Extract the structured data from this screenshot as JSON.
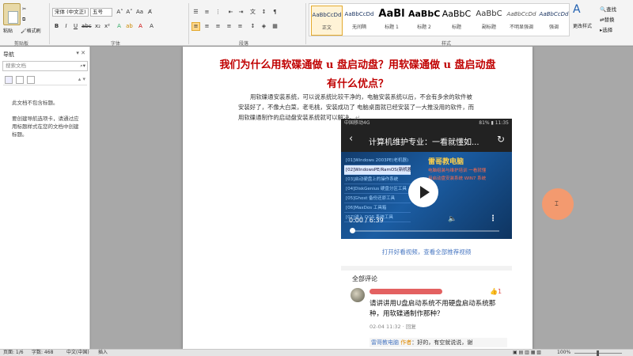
{
  "ribbon": {
    "clipboard": {
      "paste": "粘贴",
      "format_painter": "格式刷",
      "group": "剪贴板"
    },
    "font": {
      "font_name": "宋体 (中文正)",
      "font_size": "五号",
      "group": "字体"
    },
    "paragraph": {
      "group": "段落"
    },
    "styles": {
      "group": "样式",
      "items": [
        {
          "sample": "AaBbCcDd",
          "name": "正文"
        },
        {
          "sample": "AaBbCcDd",
          "name": "无间隔"
        },
        {
          "sample": "AaBl",
          "name": "标题 1"
        },
        {
          "sample": "AaBbC",
          "name": "标题 2"
        },
        {
          "sample": "AaBbC",
          "name": "标题"
        },
        {
          "sample": "AaBbC",
          "name": "副标题"
        },
        {
          "sample": "AaBbCcDd",
          "name": "不明显强调"
        },
        {
          "sample": "AaBbCcDd",
          "name": "强调"
        }
      ],
      "change_styles": "更改样式"
    },
    "editing": {
      "find": "查找",
      "replace": "替换",
      "select": "选择"
    }
  },
  "nav": {
    "title": "导航",
    "search_placeholder": "搜索文档",
    "msg1": "此文档不包含标题。",
    "msg2": "要创建导航选项卡，请通过应用标题样式在您的文档中创建标题。"
  },
  "document": {
    "title_line1": "我们为什么用软碟通做 u 盘启动盘？用软碟通做 u 盘启动盘",
    "title_line2": "有什么优点？",
    "paragraph": "用软碟通安装系统，可以说系统比较干净的，电脑安装系统以后，不会有多余的软件被安装好了，不像大白菜，老毛桃，安装成功了 电脑桌面就已经安装了一大推没用的软件，而用软碟通制作的启动盘安装系统就可以解决。",
    "para_mark": "↵"
  },
  "phone": {
    "carrier": "中国移动4G",
    "battery": "81% ▮ 11:35",
    "app_title": "计算机维护专业：一看就懂如...",
    "video": {
      "list": [
        "[01]Windows 2003PE(老机器)",
        "[02]WindowsPE/RamOS(新机器)",
        "[03]启动硬盘上的操作系统",
        "[04]DiskGenius 硬盘分区工具",
        "[05]Ghost 备份还原工具",
        "[06]MaxDos 工具箱",
        "[07]进入 DOS 系统工具"
      ],
      "brand": "雷哥教电脑",
      "red1": "电脑组装与维护培训  一看就懂",
      "red2": "用启动盘安装系统 WIN7 系统",
      "time": "0:00 / 6:39",
      "progress": 0.0
    },
    "open_link": "打开好看视频，查看全部推荐视频",
    "comments_header": "全部评论",
    "comment_text": "请讲讲用U盘启动系统不用硬盘启动系统那种，用软碟通制作那种？",
    "comment_meta": "02-04 11:32 · 回复",
    "reply_author": "雷哥教电脑",
    "reply_badge": "作者",
    "reply_text": "：好的，有空就说说，谢"
  },
  "statusbar": {
    "page": "页面: 1/6",
    "words": "字数: 468",
    "lang": "中文(中国)",
    "mode": "插入",
    "zoom": "100%"
  }
}
